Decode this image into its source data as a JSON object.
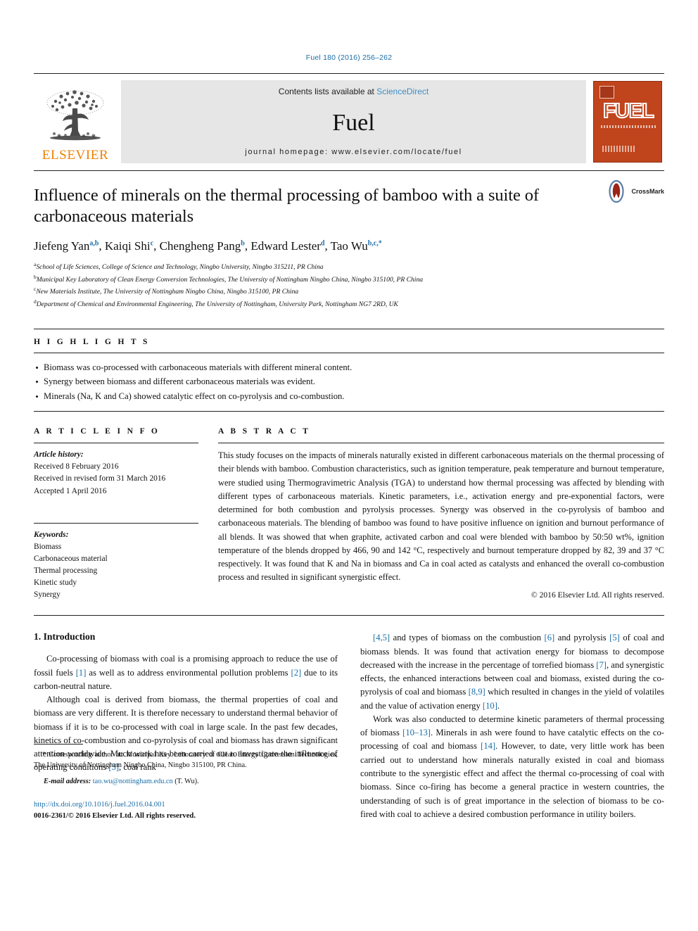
{
  "running_head": "Fuel 180 (2016) 256–262",
  "masthead": {
    "publisher_name": "ELSEVIER",
    "contents_prefix": "Contents lists available at ",
    "contents_link": "ScienceDirect",
    "journal_name": "Fuel",
    "homepage": "journal homepage: www.elsevier.com/locate/fuel",
    "cover_title": "FUEL",
    "cover_bg_color": "#c0441c",
    "link_color": "#3d8dc4"
  },
  "title": "Influence of minerals on the thermal processing of bamboo with a suite of carbonaceous materials",
  "crossmark_label": "CrossMark",
  "authors": [
    {
      "name": "Jiefeng Yan",
      "sup": "a,b",
      "sep": ", "
    },
    {
      "name": "Kaiqi Shi",
      "sup": "c",
      "sep": ", "
    },
    {
      "name": "Chengheng Pang",
      "sup": "b",
      "sep": ", "
    },
    {
      "name": "Edward Lester",
      "sup": "d",
      "sep": ", "
    },
    {
      "name": "Tao Wu",
      "sup": "b,c,",
      "sep": ""
    }
  ],
  "affiliations": [
    {
      "mark": "a",
      "text": "School of Life Sciences, College of Science and Technology, Ningbo University, Ningbo 315211, PR China"
    },
    {
      "mark": "b",
      "text": "Municipal Key Laboratory of Clean Energy Conversion Technologies, The University of Nottingham Ningbo China, Ningbo 315100, PR China"
    },
    {
      "mark": "c",
      "text": "New Materials Institute, The University of Nottingham Ningbo China, Ningbo 315100, PR China"
    },
    {
      "mark": "d",
      "text": "Department of Chemical and Environmental Engineering, The University of Nottingham, University Park, Nottingham NG7 2RD, UK"
    }
  ],
  "highlights": {
    "heading": "H I G H L I G H T S",
    "items": [
      "Biomass was co-processed with carbonaceous materials with different mineral content.",
      "Synergy between biomass and different carbonaceous materials was evident.",
      "Minerals (Na, K and Ca) showed catalytic effect on co-pyrolysis and co-combustion."
    ]
  },
  "article_info": {
    "heading": "A R T I C L E    I N F O",
    "history_label": "Article history:",
    "history": [
      "Received 8 February 2016",
      "Received in revised form 31 March 2016",
      "Accepted 1 April 2016"
    ],
    "keywords_label": "Keywords:",
    "keywords": [
      "Biomass",
      "Carbonaceous material",
      "Thermal processing",
      "Kinetic study",
      "Synergy"
    ]
  },
  "abstract": {
    "heading": "A B S T R A C T",
    "text": "This study focuses on the impacts of minerals naturally existed in different carbonaceous materials on the thermal processing of their blends with bamboo. Combustion characteristics, such as ignition temperature, peak temperature and burnout temperature, were studied using Thermogravimetric Analysis (TGA) to understand how thermal processing was affected by blending with different types of carbonaceous materials. Kinetic parameters, i.e., activation energy and pre-exponential factors, were determined for both combustion and pyrolysis processes. Synergy was observed in the co-pyrolysis of bamboo and carbonaceous materials. The blending of bamboo was found to have positive influence on ignition and burnout performance of all blends. It was showed that when graphite, activated carbon and coal were blended with bamboo by 50:50 wt%, ignition temperature of the blends dropped by 466, 90 and 142 °C, respectively and burnout temperature dropped by 82, 39 and 37 °C respectively. It was found that K and Na in biomass and Ca in coal acted as catalysts and enhanced the overall co-combustion process and resulted in significant synergistic effect.",
    "copyright": "© 2016 Elsevier Ltd. All rights reserved."
  },
  "introduction": {
    "heading": "1. Introduction",
    "left_paragraphs": [
      "Co-processing of biomass with coal is a promising approach to reduce the use of fossil fuels [1] as well as to address environmental pollution problems [2] due to its carbon-neutral nature.",
      "Although coal is derived from biomass, the thermal properties of coal and biomass are very different. It is therefore necessary to understand thermal behavior of biomass if it is to be co-processed with coal in large scale. In the past few decades, kinetics of co-combustion and co-pyrolysis of coal and biomass has drawn significant attention worldwide. Much work has been carried out to investigate the influence of operating conditions [3], coal rank"
    ],
    "right_paragraphs": [
      "[4,5] and types of biomass on the combustion [6] and pyrolysis [5] of coal and biomass blends. It was found that activation energy for biomass to decompose decreased with the increase in the percentage of torrefied biomass [7], and synergistic effects, the enhanced interactions between coal and biomass, existed during the co-pyrolysis of coal and biomass [8,9] which resulted in changes in the yield of volatiles and the value of activation energy [10].",
      "Work was also conducted to determine kinetic parameters of thermal processing of biomass [10–13]. Minerals in ash were found to have catalytic effects on the co-processing of coal and biomass [14]. However, to date, very little work has been carried out to understand how minerals naturally existed in coal and biomass contribute to the synergistic effect and affect the thermal co-processing of coal with biomass. Since co-firing has become a general practice in western countries, the understanding of such is of great importance in the selection of biomass to be co-fired with coal to achieve a desired combustion performance in utility boilers."
    ]
  },
  "footnote": {
    "star": "*",
    "corresponding": "Corresponding author at: Municipal Key Laboratory of Clean Energy Conversion Technologies, The University of Nottingham Ningbo China, Ningbo 315100, PR China.",
    "email_label": "E-mail address:",
    "email": "tao.wu@nottingham.edu.cn",
    "email_suffix": "(T. Wu).",
    "doi": "http://dx.doi.org/10.1016/j.fuel.2016.04.001",
    "issn": "0016-2361/© 2016 Elsevier Ltd. All rights reserved."
  }
}
